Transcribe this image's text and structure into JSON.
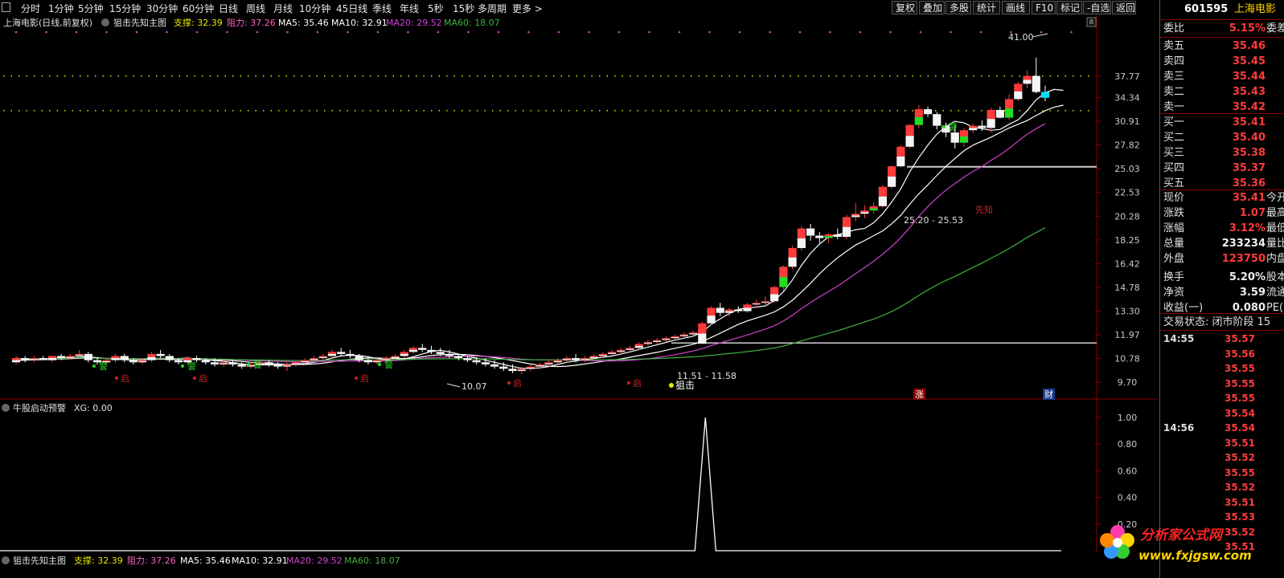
{
  "toolbar": {
    "menu_icon": "window-menu-icon",
    "periods": [
      "分时",
      "1分钟",
      "5分钟",
      "15分钟",
      "30分钟",
      "60分钟",
      "日线",
      "周线",
      "月线",
      "10分钟",
      "45日线",
      "季线",
      "年线",
      "5秒",
      "15秒",
      "多周期",
      "更多 >"
    ],
    "buttons": [
      "复权",
      "叠加",
      "多股",
      "统计",
      "画线",
      "F10",
      "标记",
      "-自选",
      "返回"
    ]
  },
  "main_legend": {
    "stock": "上海电影(日线,前复权)",
    "indicator": "狙击先知主图",
    "support_label": "支撑: 32.39",
    "resist_label": "阻力: 37.26",
    "ma5": "MA5: 35.46",
    "ma10": "MA10: 32.91",
    "ma20": "MA20: 29.52",
    "ma60": "MA60: 18.07"
  },
  "sub_legend": {
    "title": "牛股启动预警",
    "xg": "XG: 0.00"
  },
  "bottom_legend": {
    "indicator": "狙击先知主图",
    "support_label": "支撑: 32.39",
    "resist_label": "阻力: 37.26",
    "ma5": "MA5: 35.46",
    "ma10": "MA10: 32.91",
    "ma20": "MA20: 29.52",
    "ma60": "MA60: 18.07"
  },
  "colors": {
    "up": "#ff3b3b",
    "down_fill": "#00e0ff",
    "ma5": "#ffffff",
    "ma10": "#ffffff",
    "ma20": "#d040d0",
    "ma60": "#40b040",
    "signal_green": "#22dd22"
  },
  "main_axis_labels": [
    "37.77",
    "34.34",
    "30.91",
    "27.82",
    "25.03",
    "22.53",
    "20.28",
    "18.25",
    "16.42",
    "14.78",
    "13.30",
    "11.97",
    "10.78",
    "9.70"
  ],
  "sub_axis_labels": [
    "1.00",
    "0.80",
    "0.60",
    "0.40",
    "0.20"
  ],
  "annotations": {
    "high_label": "41.00",
    "low_label": "10.07",
    "range1": "25.20 - 25.53",
    "range2": "11.51 - 11.58",
    "sniper": "狙击",
    "warn": "警",
    "start": "启",
    "zhang": "涨",
    "cai": "财",
    "xianzhi": "先知"
  },
  "quote": {
    "code": "601595",
    "name": "上海电影",
    "weibi_label": "委比",
    "weibi": "5.15%",
    "weicha_label": "委差",
    "asks": [
      {
        "label": "卖五",
        "price": "35.46"
      },
      {
        "label": "卖四",
        "price": "35.45"
      },
      {
        "label": "卖三",
        "price": "35.44"
      },
      {
        "label": "卖二",
        "price": "35.43"
      },
      {
        "label": "卖一",
        "price": "35.42"
      }
    ],
    "bids": [
      {
        "label": "买一",
        "price": "35.41"
      },
      {
        "label": "买二",
        "price": "35.40"
      },
      {
        "label": "买三",
        "price": "35.38"
      },
      {
        "label": "买四",
        "price": "35.37"
      },
      {
        "label": "买五",
        "price": "35.36"
      }
    ],
    "stats": [
      {
        "label": "现价",
        "value": "35.41",
        "ext": "今开",
        "white": false
      },
      {
        "label": "涨跌",
        "value": "1.07",
        "ext": "最高",
        "white": false
      },
      {
        "label": "涨幅",
        "value": "3.12%",
        "ext": "最低",
        "white": false
      },
      {
        "label": "总量",
        "value": "233234",
        "ext": "量比",
        "white": true
      },
      {
        "label": "外盘",
        "value": "123750",
        "ext": "内盘",
        "white": false
      },
      {
        "label": "换手",
        "value": "5.20%",
        "ext": "股本",
        "white": true
      },
      {
        "label": "净资",
        "value": "3.59",
        "ext": "流通",
        "white": true
      },
      {
        "label": "收益(一)",
        "value": "0.080",
        "ext": "PE(动",
        "white": true
      }
    ],
    "status": "交易状态: 闭市阶段 15",
    "ticks": [
      {
        "time": "14:55",
        "price": "35.57"
      },
      {
        "time": "",
        "price": "35.56"
      },
      {
        "time": "",
        "price": "35.55"
      },
      {
        "time": "",
        "price": "35.55"
      },
      {
        "time": "",
        "price": "35.55"
      },
      {
        "time": "",
        "price": "35.54"
      },
      {
        "time": "14:56",
        "price": "35.54"
      },
      {
        "time": "",
        "price": "35.51"
      },
      {
        "time": "",
        "price": "35.52"
      },
      {
        "time": "",
        "price": "35.55"
      },
      {
        "time": "",
        "price": "35.52"
      },
      {
        "time": "",
        "price": "35.51"
      },
      {
        "time": "",
        "price": "35.53"
      },
      {
        "time": "",
        "price": "35.52"
      },
      {
        "time": "",
        "price": "35.51"
      }
    ]
  },
  "watermark": {
    "name": "分析家公式网",
    "url": "www.fxjgsw.com"
  },
  "candles": [
    [
      10.6,
      10.9,
      10.5,
      10.8
    ],
    [
      10.8,
      10.9,
      10.6,
      10.7
    ],
    [
      10.7,
      10.9,
      10.6,
      10.8
    ],
    [
      10.8,
      10.9,
      10.7,
      10.7
    ],
    [
      10.7,
      10.9,
      10.6,
      10.9
    ],
    [
      10.9,
      11.0,
      10.7,
      10.8
    ],
    [
      10.8,
      11.0,
      10.7,
      10.9
    ],
    [
      10.9,
      11.2,
      10.8,
      11.0
    ],
    [
      11.0,
      11.1,
      10.6,
      10.7
    ],
    [
      10.7,
      10.8,
      10.5,
      10.6
    ],
    [
      10.6,
      10.8,
      10.5,
      10.7
    ],
    [
      10.7,
      11.0,
      10.6,
      10.9
    ],
    [
      10.9,
      11.0,
      10.6,
      10.7
    ],
    [
      10.7,
      10.8,
      10.5,
      10.6
    ],
    [
      10.6,
      10.8,
      10.5,
      10.7
    ],
    [
      10.7,
      11.1,
      10.6,
      11.0
    ],
    [
      11.0,
      11.2,
      10.8,
      10.9
    ],
    [
      10.9,
      11.0,
      10.6,
      10.7
    ],
    [
      10.7,
      10.8,
      10.5,
      10.6
    ],
    [
      10.6,
      10.9,
      10.5,
      10.8
    ],
    [
      10.8,
      10.9,
      10.6,
      10.7
    ],
    [
      10.7,
      10.8,
      10.5,
      10.6
    ],
    [
      10.6,
      10.8,
      10.4,
      10.5
    ],
    [
      10.5,
      10.7,
      10.4,
      10.6
    ],
    [
      10.6,
      10.7,
      10.4,
      10.5
    ],
    [
      10.5,
      10.6,
      10.3,
      10.4
    ],
    [
      10.4,
      10.6,
      10.3,
      10.5
    ],
    [
      10.5,
      10.7,
      10.4,
      10.6
    ],
    [
      10.6,
      10.7,
      10.4,
      10.5
    ],
    [
      10.5,
      10.6,
      10.3,
      10.4
    ],
    [
      10.4,
      10.6,
      10.2,
      10.5
    ],
    [
      10.5,
      10.7,
      10.4,
      10.6
    ],
    [
      10.6,
      10.8,
      10.5,
      10.7
    ],
    [
      10.7,
      10.9,
      10.6,
      10.8
    ],
    [
      10.8,
      11.0,
      10.7,
      10.9
    ],
    [
      10.9,
      11.2,
      10.8,
      11.1
    ],
    [
      11.1,
      11.3,
      10.9,
      11.0
    ],
    [
      11.0,
      11.2,
      10.8,
      10.9
    ],
    [
      10.9,
      11.0,
      10.6,
      10.7
    ],
    [
      10.7,
      10.9,
      10.5,
      10.6
    ],
    [
      10.6,
      10.8,
      10.5,
      10.7
    ],
    [
      10.7,
      10.9,
      10.6,
      10.8
    ],
    [
      10.8,
      11.0,
      10.7,
      10.9
    ],
    [
      10.9,
      11.2,
      10.8,
      11.1
    ],
    [
      11.1,
      11.4,
      11.0,
      11.3
    ],
    [
      11.3,
      11.5,
      11.1,
      11.2
    ],
    [
      11.2,
      11.4,
      11.0,
      11.1
    ],
    [
      11.1,
      11.3,
      10.9,
      11.0
    ],
    [
      11.0,
      11.2,
      10.8,
      10.9
    ],
    [
      10.9,
      11.0,
      10.7,
      10.8
    ],
    [
      10.8,
      10.9,
      10.6,
      10.7
    ],
    [
      10.7,
      10.8,
      10.5,
      10.6
    ],
    [
      10.6,
      10.8,
      10.4,
      10.5
    ],
    [
      10.5,
      10.7,
      10.3,
      10.4
    ],
    [
      10.4,
      10.6,
      10.2,
      10.3
    ],
    [
      10.3,
      10.5,
      10.1,
      10.2
    ],
    [
      10.2,
      10.4,
      10.07,
      10.3
    ],
    [
      10.3,
      10.5,
      10.2,
      10.4
    ],
    [
      10.4,
      10.6,
      10.3,
      10.5
    ],
    [
      10.5,
      10.7,
      10.4,
      10.6
    ],
    [
      10.6,
      10.8,
      10.5,
      10.7
    ],
    [
      10.7,
      10.9,
      10.6,
      10.8
    ],
    [
      10.8,
      11.0,
      10.6,
      10.7
    ],
    [
      10.7,
      10.9,
      10.6,
      10.8
    ],
    [
      10.8,
      11.0,
      10.7,
      10.9
    ],
    [
      10.9,
      11.1,
      10.8,
      11.0
    ],
    [
      11.0,
      11.2,
      10.9,
      11.1
    ],
    [
      11.1,
      11.3,
      11.0,
      11.2
    ],
    [
      11.2,
      11.4,
      11.1,
      11.3
    ],
    [
      11.3,
      11.6,
      11.2,
      11.5
    ],
    [
      11.5,
      11.7,
      11.4,
      11.6
    ],
    [
      11.6,
      11.8,
      11.5,
      11.7
    ],
    [
      11.7,
      11.9,
      11.6,
      11.8
    ],
    [
      11.8,
      12.0,
      11.7,
      11.9
    ],
    [
      11.9,
      12.1,
      11.8,
      12.0
    ],
    [
      12.0,
      12.2,
      11.9,
      12.1
    ],
    [
      11.51,
      12.7,
      11.5,
      12.6
    ],
    [
      12.6,
      13.6,
      12.5,
      13.5
    ],
    [
      13.5,
      13.8,
      13.0,
      13.2
    ],
    [
      13.2,
      13.5,
      13.0,
      13.4
    ],
    [
      13.4,
      13.6,
      13.2,
      13.3
    ],
    [
      13.3,
      13.8,
      13.2,
      13.7
    ],
    [
      13.7,
      14.0,
      13.5,
      13.8
    ],
    [
      13.8,
      14.2,
      13.7,
      13.9
    ],
    [
      13.9,
      14.9,
      13.8,
      14.8
    ],
    [
      14.8,
      16.3,
      14.6,
      16.2
    ],
    [
      16.2,
      17.8,
      16.0,
      17.6
    ],
    [
      17.6,
      19.4,
      17.4,
      19.2
    ],
    [
      19.2,
      19.6,
      18.2,
      18.6
    ],
    [
      18.6,
      18.9,
      18.0,
      18.4
    ],
    [
      18.4,
      18.8,
      18.0,
      18.7
    ],
    [
      18.7,
      19.2,
      18.3,
      18.5
    ],
    [
      18.5,
      20.4,
      18.3,
      20.2
    ],
    [
      20.2,
      21.5,
      19.8,
      20.5
    ],
    [
      20.5,
      21.3,
      20.1,
      20.8
    ],
    [
      20.8,
      21.6,
      20.5,
      21.2
    ],
    [
      21.2,
      23.3,
      21.0,
      23.1
    ],
    [
      23.1,
      25.4,
      22.9,
      25.3
    ],
    [
      25.3,
      27.8,
      25.2,
      27.6
    ],
    [
      27.6,
      30.5,
      27.4,
      30.4
    ],
    [
      30.4,
      33.2,
      30.0,
      32.6
    ],
    [
      32.6,
      33.0,
      31.5,
      31.9
    ],
    [
      31.9,
      32.2,
      29.8,
      30.3
    ],
    [
      30.3,
      30.7,
      28.8,
      29.4
    ],
    [
      29.4,
      30.5,
      27.4,
      28.1
    ],
    [
      28.1,
      30.0,
      27.6,
      29.7
    ],
    [
      29.7,
      30.6,
      29.3,
      30.3
    ],
    [
      30.3,
      31.0,
      29.6,
      30.0
    ],
    [
      30.0,
      32.8,
      29.4,
      32.5
    ],
    [
      32.5,
      33.0,
      31.3,
      31.4
    ],
    [
      31.4,
      34.8,
      31.1,
      34.1
    ],
    [
      34.1,
      36.8,
      33.8,
      36.5
    ],
    [
      36.5,
      38.8,
      35.8,
      37.8
    ],
    [
      37.8,
      41.0,
      35.0,
      35.2
    ],
    [
      35.2,
      36.2,
      33.8,
      34.3
    ]
  ],
  "ma5": [
    10.7,
    10.7,
    10.75,
    10.76,
    10.78,
    10.8,
    10.81,
    10.86,
    10.86,
    10.82,
    10.78,
    10.78,
    10.72,
    10.7,
    10.7,
    10.78,
    10.78,
    10.78,
    10.78,
    10.8,
    10.76,
    10.72,
    10.68,
    10.64,
    10.58,
    10.52,
    10.48,
    10.48,
    10.48,
    10.48,
    10.48,
    10.52,
    10.54,
    10.6,
    10.68,
    10.8,
    10.9,
    10.94,
    10.92,
    10.86,
    10.78,
    10.72,
    10.72,
    10.76,
    10.86,
    11.0,
    11.12,
    11.18,
    11.1,
    11.0,
    10.88,
    10.8,
    10.7,
    10.6,
    10.5,
    10.4,
    10.32,
    10.32,
    10.34,
    10.4,
    10.5,
    10.6,
    10.66,
    10.72,
    10.78,
    10.84,
    10.9,
    11.0,
    11.1,
    11.22,
    11.34,
    11.46,
    11.58,
    11.7,
    11.8,
    11.9,
    12.12,
    12.54,
    12.86,
    13.16,
    13.4,
    13.5,
    13.54,
    13.62,
    13.94,
    14.5,
    15.28,
    16.3,
    17.2,
    17.92,
    18.5,
    18.68,
    18.88,
    19.1,
    19.2,
    19.7,
    20.5,
    21.6,
    22.9,
    24.7,
    26.3,
    27.8,
    29.2,
    30.2,
    30.9,
    30.7,
    30.1,
    29.9,
    29.7,
    29.8,
    30.5,
    31.1,
    32.4,
    34.0,
    35.1,
    35.6,
    35.46
  ],
  "ma10": [
    10.7,
    10.7,
    10.72,
    10.73,
    10.75,
    10.76,
    10.77,
    10.79,
    10.8,
    10.8,
    10.78,
    10.78,
    10.78,
    10.76,
    10.75,
    10.76,
    10.75,
    10.74,
    10.74,
    10.75,
    10.75,
    10.74,
    10.72,
    10.7,
    10.68,
    10.64,
    10.6,
    10.57,
    10.54,
    10.52,
    10.5,
    10.5,
    10.5,
    10.52,
    10.56,
    10.62,
    10.68,
    10.74,
    10.78,
    10.8,
    10.8,
    10.79,
    10.78,
    10.78,
    10.8,
    10.86,
    10.92,
    10.96,
    10.98,
    10.98,
    10.96,
    10.92,
    10.88,
    10.82,
    10.76,
    10.68,
    10.6,
    10.52,
    10.46,
    10.42,
    10.4,
    10.42,
    10.46,
    10.52,
    10.58,
    10.64,
    10.7,
    10.76,
    10.84,
    10.92,
    11.0,
    11.08,
    11.18,
    11.28,
    11.38,
    11.48,
    11.62,
    11.84,
    12.06,
    12.3,
    12.54,
    12.74,
    12.9,
    13.06,
    13.26,
    13.56,
    13.96,
    14.48,
    15.06,
    15.7,
    16.3,
    16.86,
    17.36,
    17.84,
    18.2,
    18.6,
    19.0,
    19.6,
    20.36,
    21.4,
    22.4,
    23.3,
    24.3,
    25.3,
    26.2,
    27.1,
    27.8,
    28.3,
    28.8,
    29.4,
    30.0,
    30.5,
    31.0,
    31.7,
    32.4,
    32.91,
    33.2
  ],
  "ma20": [],
  "ma60": []
}
